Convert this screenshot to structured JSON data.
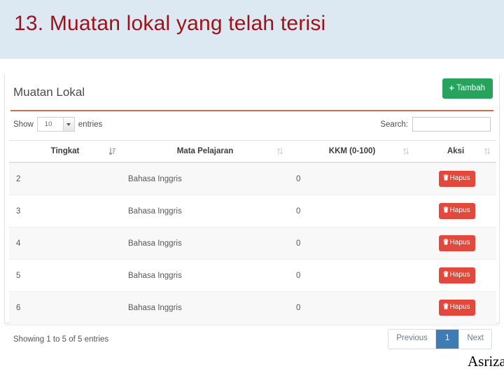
{
  "slide": {
    "title": "13. Muatan lokal yang telah terisi",
    "title_color": "#9e1118",
    "band_color": "#dce8f2",
    "credit": "Asriza"
  },
  "card": {
    "heading": "Muatan Lokal",
    "add_button": {
      "label": "Tambah",
      "plus": "+",
      "color": "#27a35c"
    },
    "rule_color": "#d9694f"
  },
  "controls": {
    "show_label": "Show",
    "entries_label": "entries",
    "page_length": "10",
    "search_label": "Search:",
    "search_value": "",
    "search_placeholder": ""
  },
  "table": {
    "columns": [
      {
        "label": "Tingkat",
        "sort": "asc"
      },
      {
        "label": "Mata Pelajaran",
        "sort": "none"
      },
      {
        "label": "KKM (0-100)",
        "sort": "none"
      },
      {
        "label": "Aksi",
        "sort": "none"
      }
    ],
    "rows": [
      {
        "tingkat": "2",
        "mapel": "Bahasa Inggris",
        "kkm": "0",
        "aksi": "Hapus"
      },
      {
        "tingkat": "3",
        "mapel": "Bahasa Inggris",
        "kkm": "0",
        "aksi": "Hapus"
      },
      {
        "tingkat": "4",
        "mapel": "Bahasa Inggris",
        "kkm": "0",
        "aksi": "Hapus"
      },
      {
        "tingkat": "5",
        "mapel": "Bahasa Inggris",
        "kkm": "0",
        "aksi": "Hapus"
      },
      {
        "tingkat": "6",
        "mapel": "Bahasa Inggris",
        "kkm": "0",
        "aksi": "Hapus"
      }
    ],
    "delete_button_color": "#e2483c"
  },
  "footer": {
    "info": "Showing 1 to 5 of 5 entries",
    "pagination": {
      "previous": "Previous",
      "current_page": "1",
      "next": "Next",
      "active_color": "#3f7cb4"
    }
  }
}
